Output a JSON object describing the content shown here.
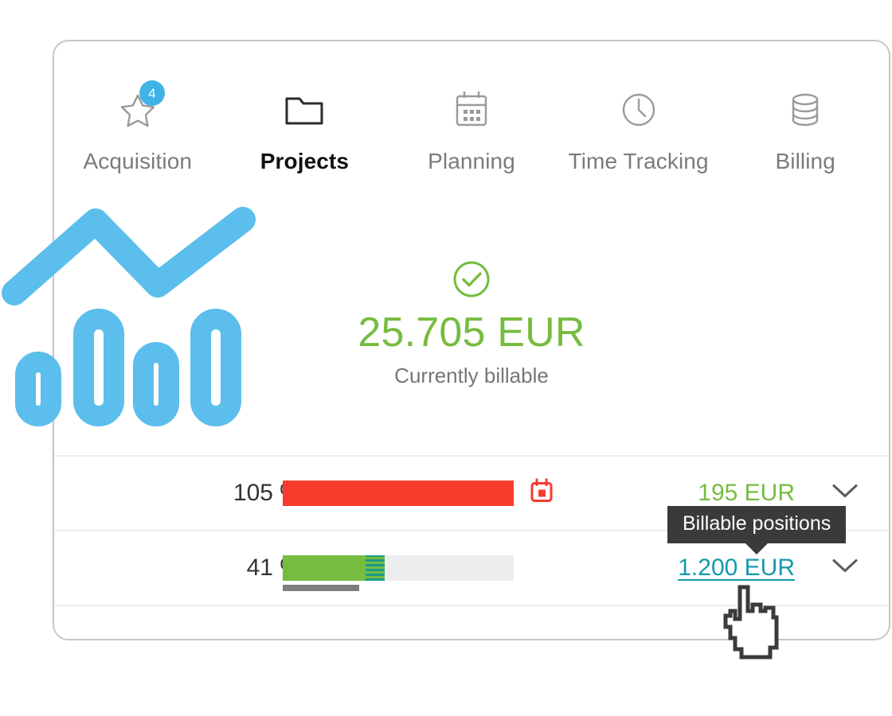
{
  "theme": {
    "accent_green": "#76bc3f",
    "accent_blue": "#3fb3e6",
    "accent_red": "#f93b2e",
    "link_teal": "#139aaa",
    "tooltip_bg": "#3a3a3a",
    "border_gray": "#c6c6c6",
    "track_gray": "#ededed"
  },
  "nav": {
    "items": [
      {
        "label": "Acquisition",
        "icon": "star-icon",
        "badge": "4",
        "active": false
      },
      {
        "label": "Projects",
        "icon": "folder-icon",
        "badge": null,
        "active": true
      },
      {
        "label": "Planning",
        "icon": "calendar-icon",
        "badge": null,
        "active": false
      },
      {
        "label": "Time Tracking",
        "icon": "clock-icon",
        "badge": null,
        "active": false
      },
      {
        "label": "Billing",
        "icon": "coins-stack-icon",
        "badge": null,
        "active": false
      }
    ]
  },
  "hero": {
    "icon": "check-circle-icon",
    "amount": "25.705 EUR",
    "caption": "Currently billable"
  },
  "rows": [
    {
      "percent": "105 %",
      "bar": {
        "fill_percent": 100,
        "fill_color": "#f93b2e",
        "hatch_percent": 0,
        "sub_percent": 0
      },
      "deadline_icon": "calendar-alert-icon",
      "amount": "195 EUR",
      "amount_style": "green",
      "chevron": "chevron-down-icon"
    },
    {
      "percent": "41 %",
      "bar": {
        "fill_percent": 36,
        "fill_color": "#76bc3f",
        "hatch_percent": 8,
        "sub_percent": 33
      },
      "deadline_icon": null,
      "amount": "1.200 EUR",
      "amount_style": "link",
      "chevron": "chevron-down-icon"
    }
  ],
  "tooltip": {
    "text": "Billable positions"
  },
  "cursor": {
    "icon": "pointing-hand-cursor"
  }
}
